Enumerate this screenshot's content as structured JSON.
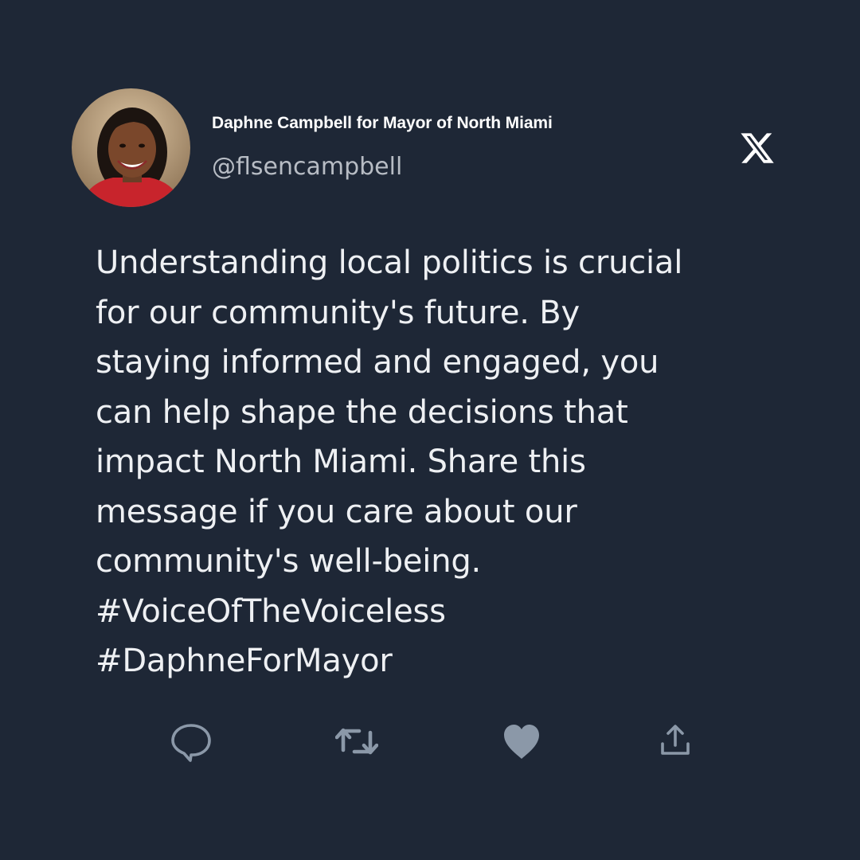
{
  "author": {
    "display_name": "Daphne Campbell for Mayor of North Miami",
    "handle": "@flsencampbell",
    "avatar_icon": "profile-photo"
  },
  "platform_icon": "x-logo-icon",
  "tweet": {
    "text": "Understanding local politics is crucial\nfor our community's future. By\nstaying informed and engaged, you\ncan help shape the decisions that\nimpact North Miami. Share this\nmessage if you care about our\ncommunity's well-being.\n#VoiceOfTheVoiceless\n#DaphneForMayor"
  },
  "actions": [
    {
      "icon": "reply-icon"
    },
    {
      "icon": "retweet-icon"
    },
    {
      "icon": "like-icon"
    },
    {
      "icon": "share-icon"
    }
  ],
  "colors": {
    "background": "#1e2736",
    "text": "#eef0f3",
    "handle": "#b7bcc4",
    "action_icons": "#8b98a8"
  }
}
